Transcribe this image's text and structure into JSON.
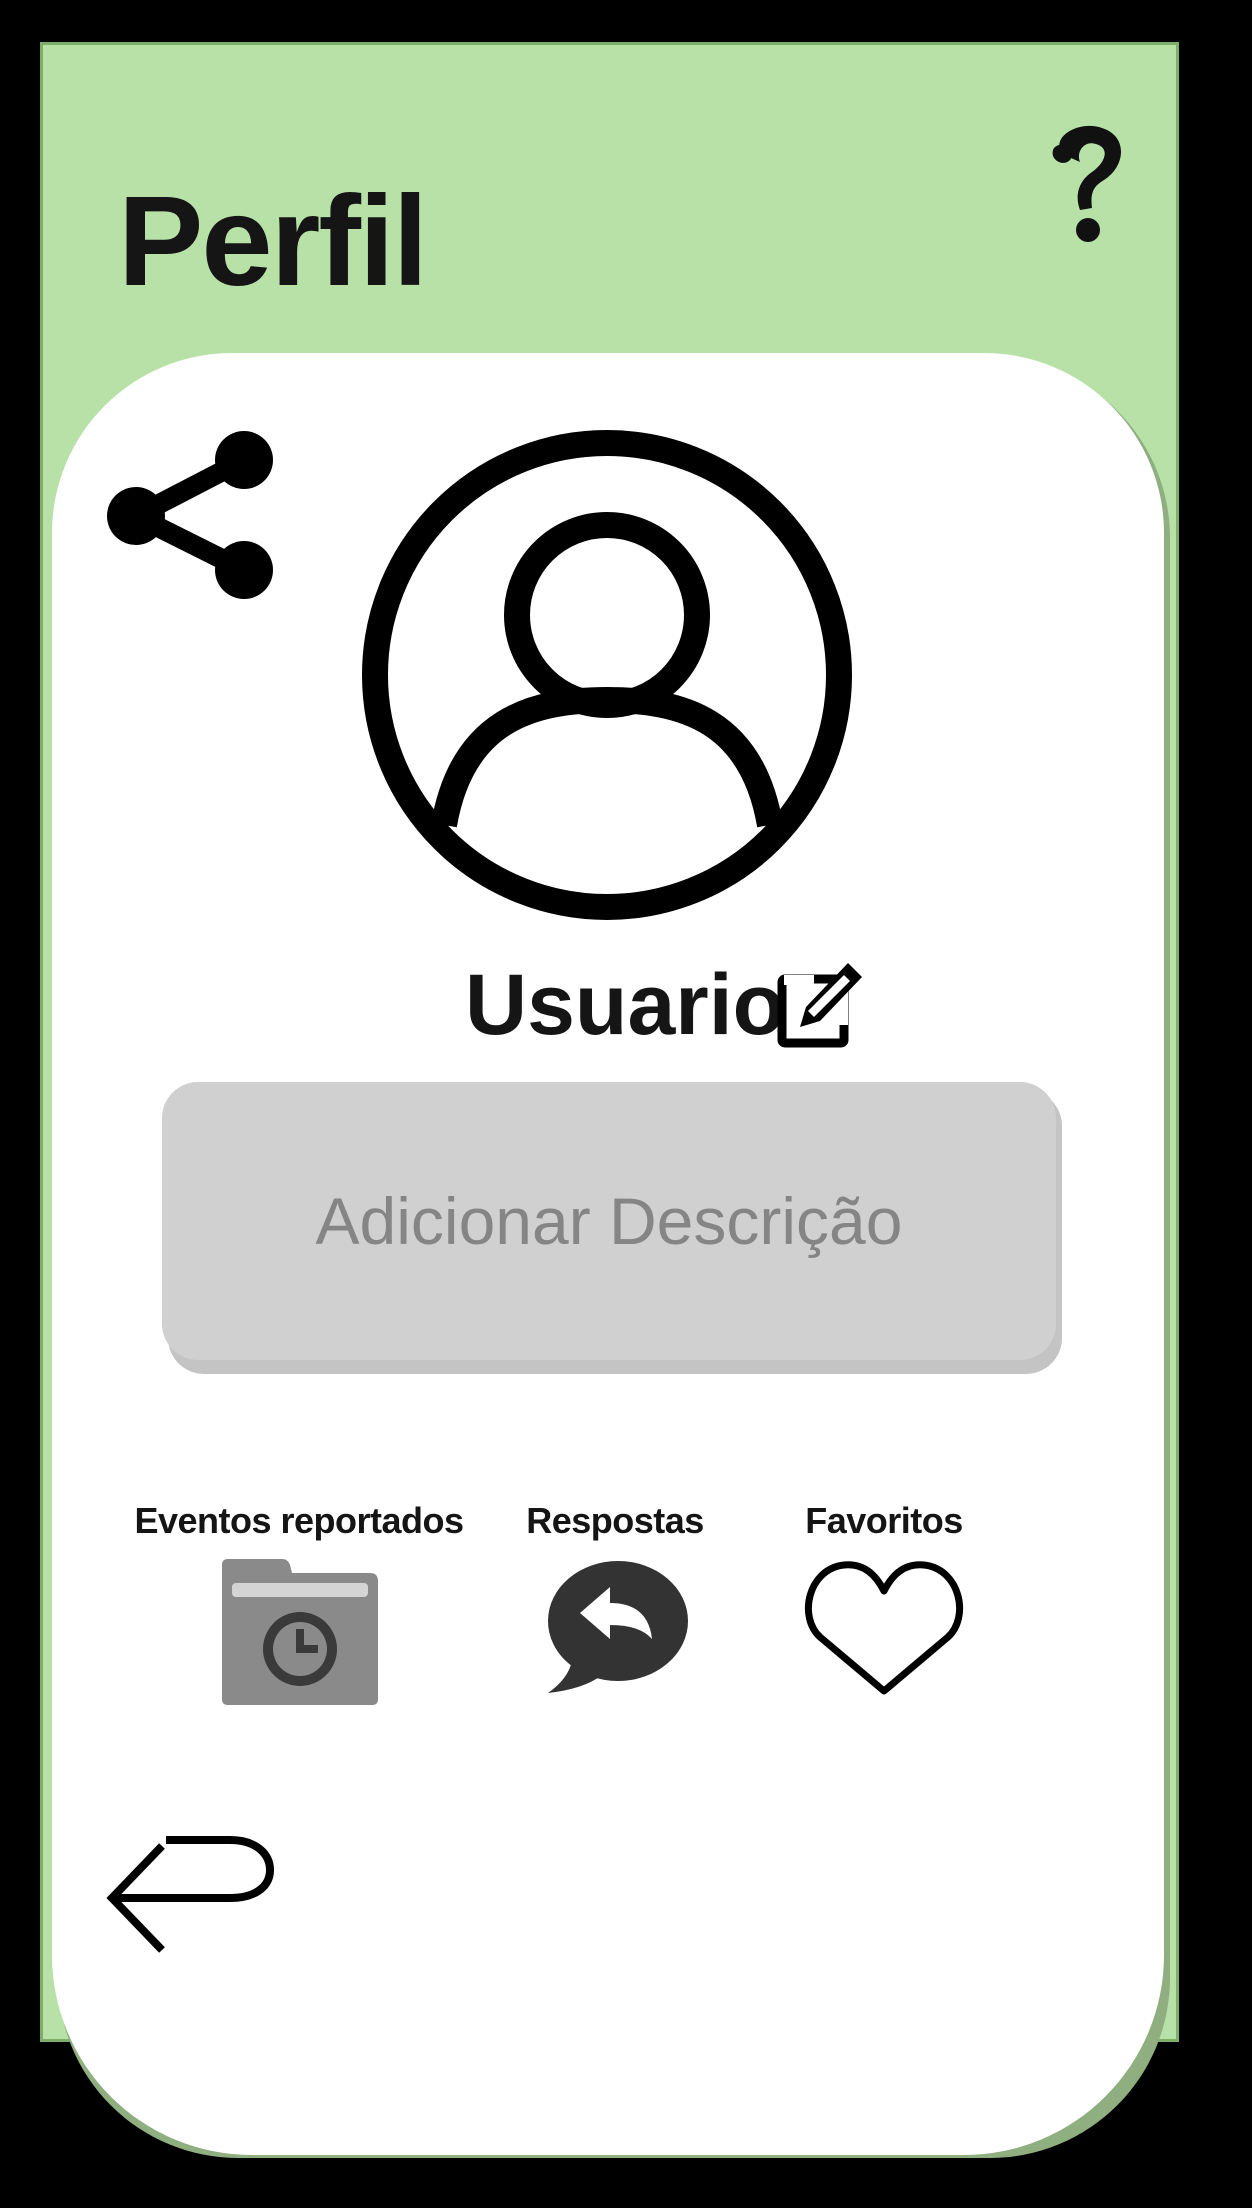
{
  "header": {
    "title": "Perfil",
    "help_icon": "question-mark-icon"
  },
  "profile": {
    "share_icon": "share-icon",
    "avatar_icon": "user-circle-icon",
    "username": "Usuario",
    "edit_icon": "edit-square-icon",
    "description_placeholder": "Adicionar Descrição"
  },
  "actions": [
    {
      "label": "Eventos reportados",
      "icon": "folder-clock-icon"
    },
    {
      "label": "Respostas",
      "icon": "reply-bubble-icon"
    },
    {
      "label": "Favoritos",
      "icon": "heart-icon"
    }
  ],
  "navigation": {
    "back_icon": "return-arrow-icon"
  },
  "colors": {
    "header_background": "#b8e1a8",
    "card_background": "#ffffff",
    "description_background": "#d0d0d0",
    "description_text": "#858585",
    "text": "#151515",
    "folder_icon": "#8a8a8a",
    "reply_icon": "#333333"
  }
}
